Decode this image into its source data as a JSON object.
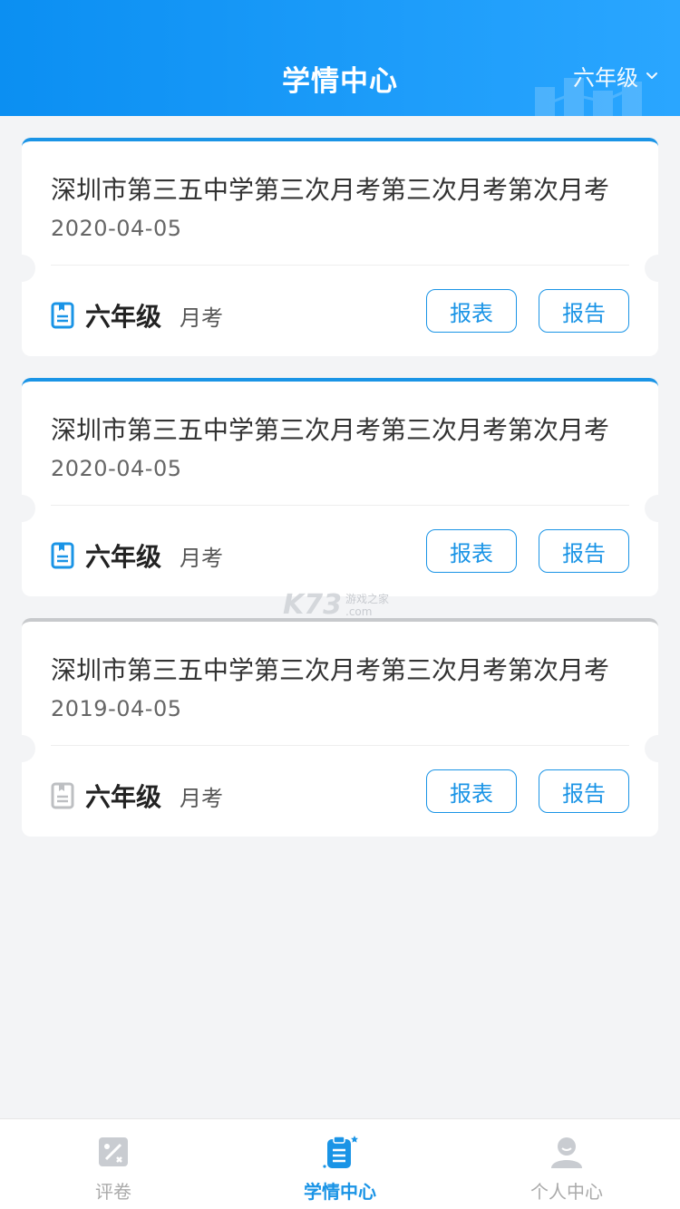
{
  "header": {
    "title": "学情中心",
    "grade_selector": "六年级"
  },
  "cards": [
    {
      "title": "深圳市第三五中学第三次月考第三次月考第次月考",
      "date": "2020-04-05",
      "grade": "六年级",
      "exam_type": "月考",
      "btn_table": "报表",
      "btn_report": "报告",
      "state": "active"
    },
    {
      "title": "深圳市第三五中学第三次月考第三次月考第次月考",
      "date": "2020-04-05",
      "grade": "六年级",
      "exam_type": "月考",
      "btn_table": "报表",
      "btn_report": "报告",
      "state": "active"
    },
    {
      "title": "深圳市第三五中学第三次月考第三次月考第次月考",
      "date": "2019-04-05",
      "grade": "六年级",
      "exam_type": "月考",
      "btn_table": "报表",
      "btn_report": "报告",
      "state": "inactive"
    }
  ],
  "watermark": {
    "logo": "K73",
    "cn": "游戏之家",
    "domain": ".com"
  },
  "tabbar": {
    "items": [
      {
        "label": "评卷",
        "icon": "grade-paper-icon",
        "active": false
      },
      {
        "label": "学情中心",
        "icon": "clipboard-icon",
        "active": true
      },
      {
        "label": "个人中心",
        "icon": "user-icon",
        "active": false
      }
    ]
  },
  "colors": {
    "accent": "#1a94e6",
    "header_start": "#0b8ff2",
    "header_end": "#2aa6ff",
    "inactive": "#c7c9cc"
  }
}
